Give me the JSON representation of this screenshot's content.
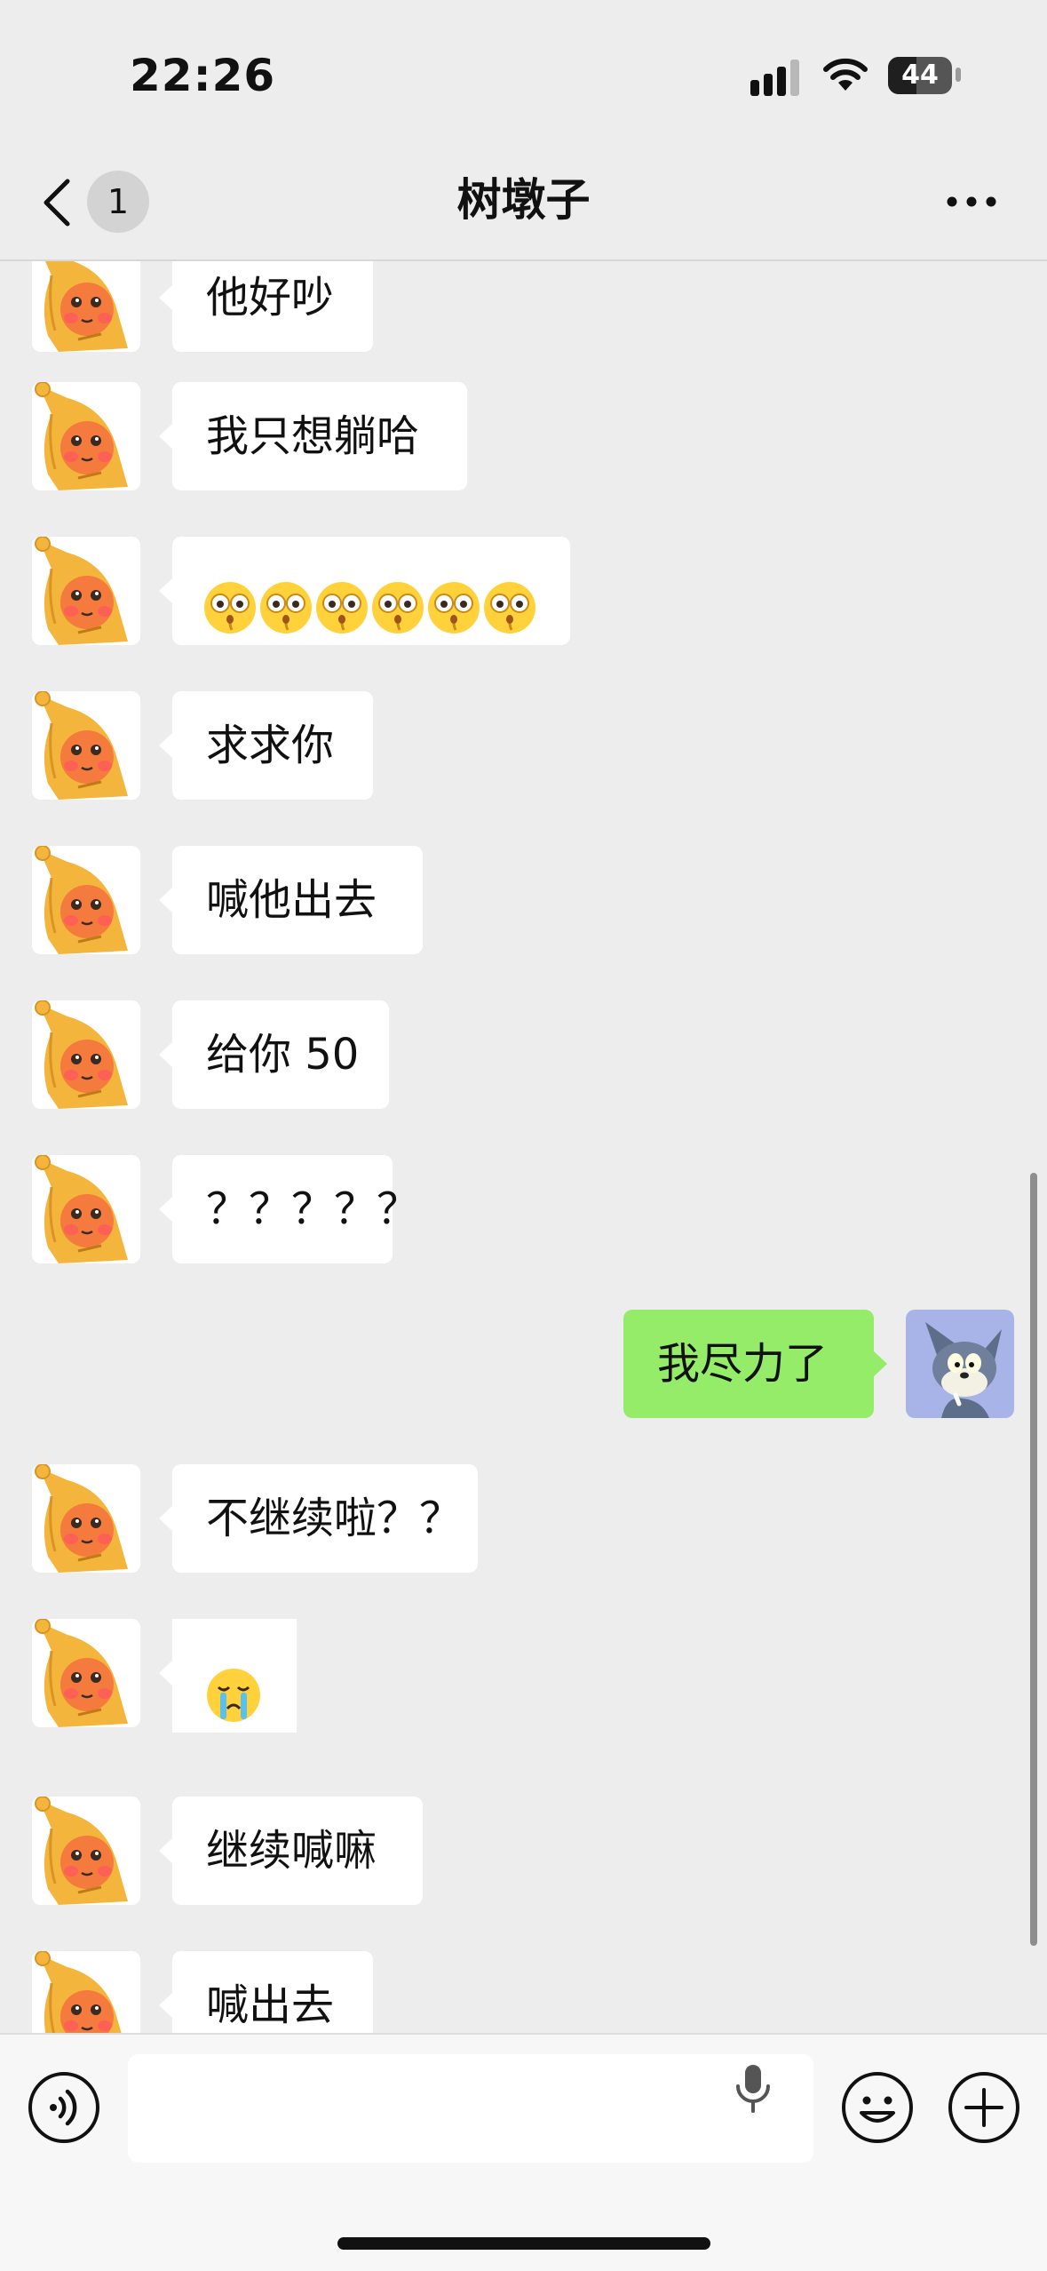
{
  "status_bar": {
    "time": "22:26",
    "battery_level": "44",
    "battery_fraction": 0.44
  },
  "header": {
    "unread_count": "1",
    "title": "树墩子"
  },
  "messages": [
    {
      "direction": "incoming",
      "text": "他好吵"
    },
    {
      "direction": "incoming",
      "text": "我只想躺哈"
    },
    {
      "direction": "incoming",
      "type": "emoji",
      "emoji_name": "monocle-face-emoji",
      "emoji_count": 6
    },
    {
      "direction": "incoming",
      "text": "求求你"
    },
    {
      "direction": "incoming",
      "text": "喊他出去"
    },
    {
      "direction": "incoming",
      "text": "给你 50"
    },
    {
      "direction": "incoming",
      "text": "？？？？？"
    },
    {
      "direction": "outgoing",
      "text": "我尽力了"
    },
    {
      "direction": "incoming",
      "text": "不继续啦？？"
    },
    {
      "direction": "incoming",
      "type": "emoji",
      "emoji_name": "crying-face-emoji",
      "emoji_count": 1
    },
    {
      "direction": "incoming",
      "text": "继续喊嘛"
    },
    {
      "direction": "incoming",
      "text": "喊出去"
    }
  ],
  "avatars": {
    "contact": "yellow-hooded-cartoon-avatar",
    "self": "cartoon-cat-avatar"
  },
  "input_bar": {
    "text": "",
    "icons": [
      "voice-icon",
      "microphone-icon",
      "emoji-icon",
      "plus-icon"
    ]
  },
  "colors": {
    "background": "#ededed",
    "incoming_bubble": "#ffffff",
    "outgoing_bubble": "#95ec69"
  }
}
